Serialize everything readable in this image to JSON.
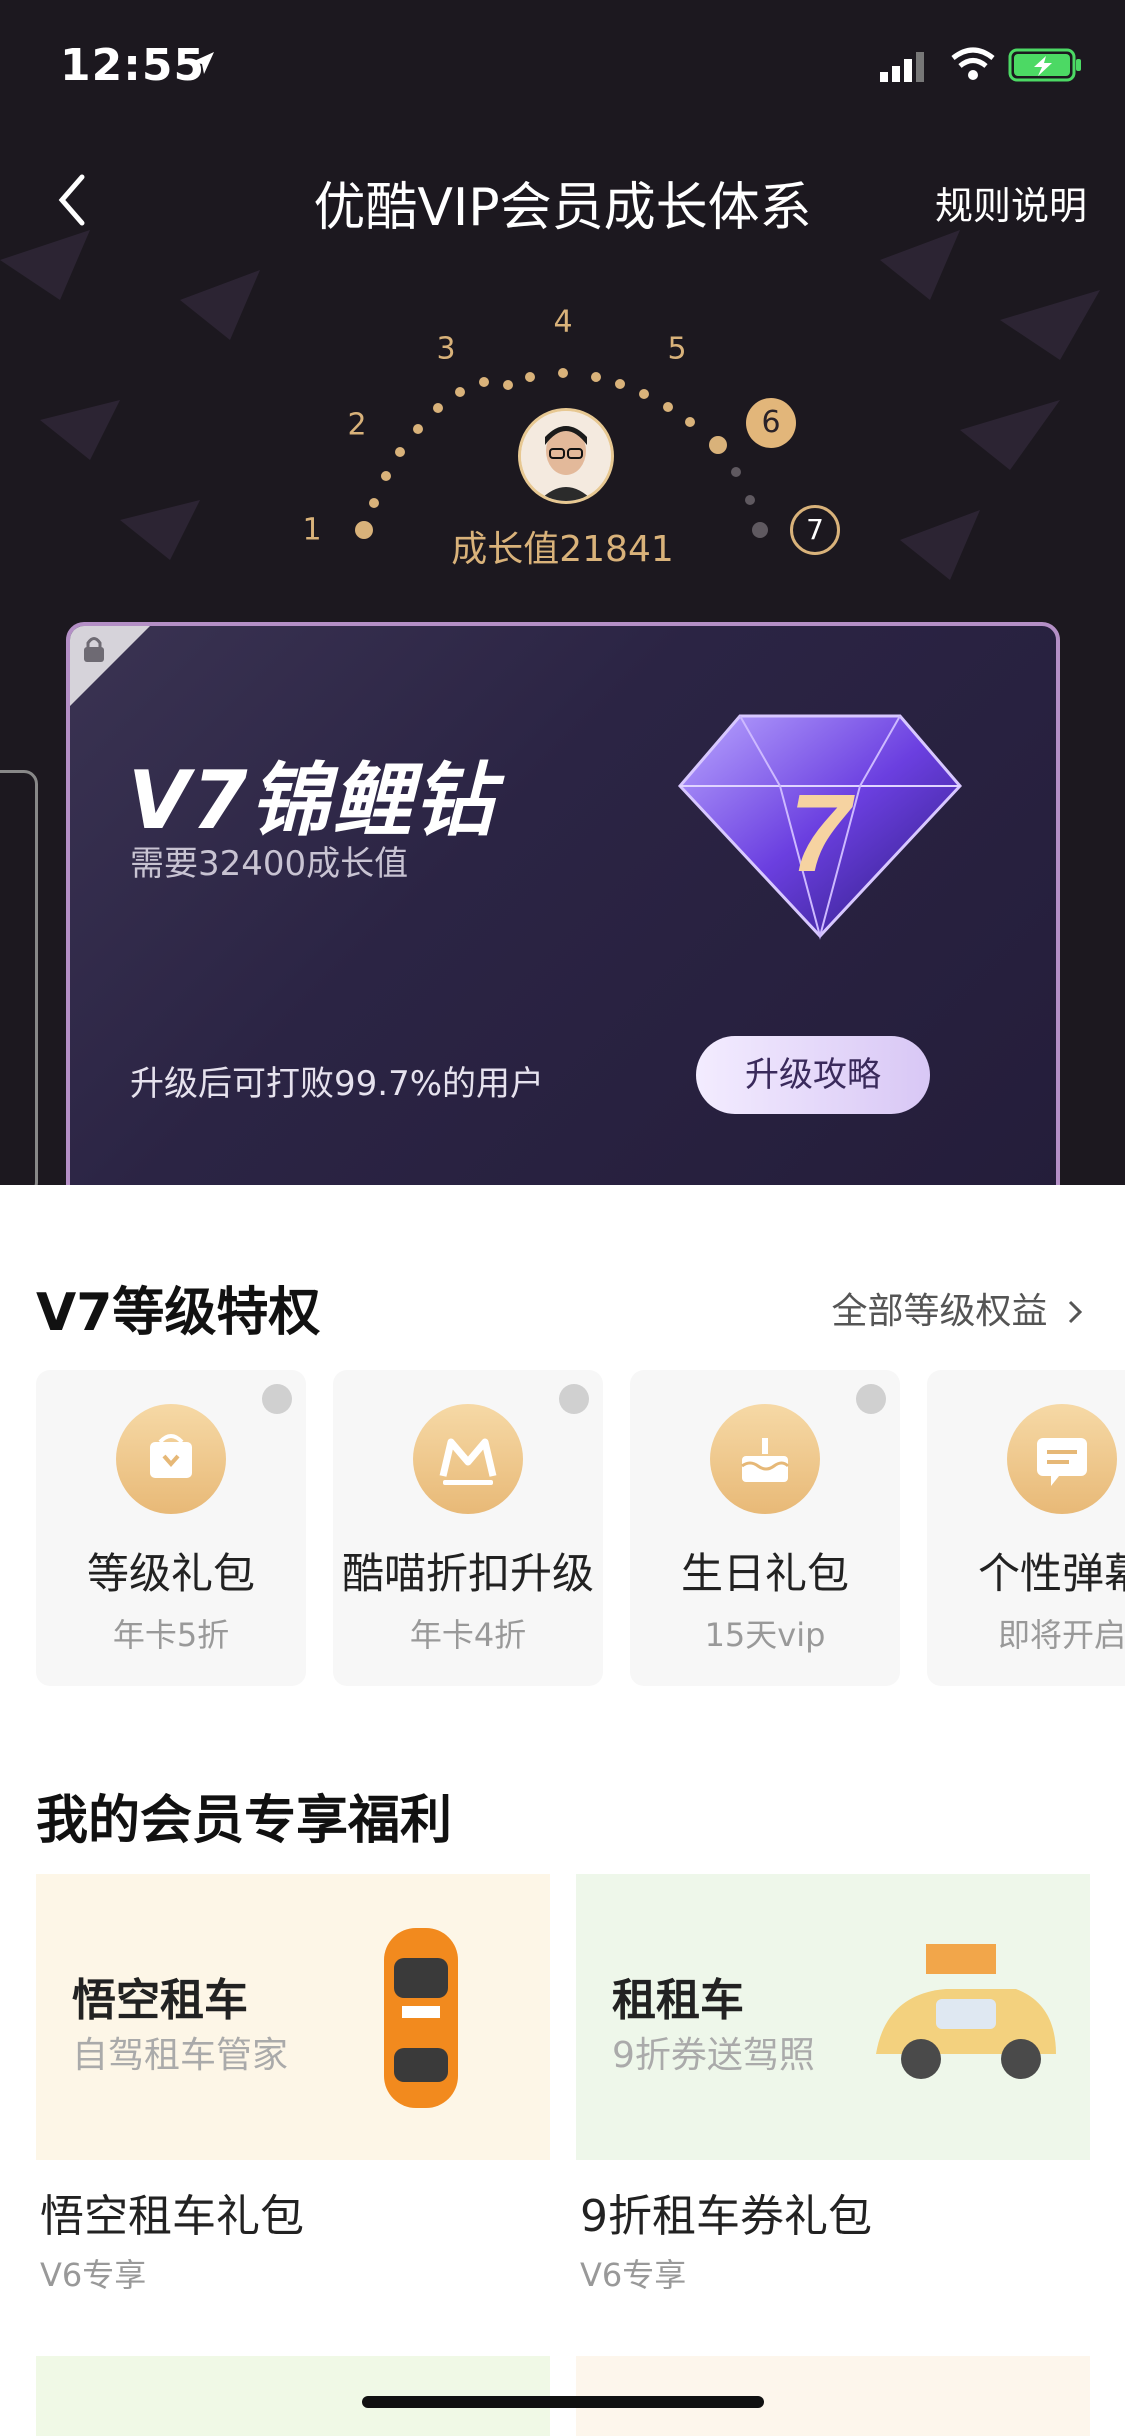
{
  "status_bar": {
    "time": "12:55"
  },
  "nav": {
    "title": "优酷VIP会员成长体系",
    "rules_link": "规则说明"
  },
  "levels": {
    "labels": [
      "1",
      "2",
      "3",
      "4",
      "5",
      "6",
      "7"
    ],
    "current": "6",
    "next": "7",
    "growth_text": "成长值21841"
  },
  "card": {
    "title": "V7锦鲤钻",
    "required": "需要32400成长值",
    "beat_text": "升级后可打败99.7%的用户",
    "upgrade_button": "升级攻略",
    "badge_number": "7"
  },
  "privileges": {
    "title": "V7等级特权",
    "all_link": "全部等级权益",
    "items": [
      {
        "name": "等级礼包",
        "desc": "年卡5折",
        "icon": "gift-icon"
      },
      {
        "name": "酷喵折扣升级",
        "desc": "年卡4折",
        "icon": "kumiao-icon"
      },
      {
        "name": "生日礼包",
        "desc": "15天vip",
        "icon": "cake-icon"
      },
      {
        "name": "个性弹幕",
        "desc": "即将开启",
        "icon": "bullet-comment-icon"
      }
    ]
  },
  "benefits": {
    "title": "我的会员专享福利",
    "items": [
      {
        "name": "悟空租车",
        "sub": "自驾租车管家",
        "title": "悟空租车礼包",
        "tag": "V6专享",
        "bg": "#fdf6e7"
      },
      {
        "name": "租租车",
        "sub": "9折券送驾照",
        "title": "9折租车券礼包",
        "tag": "V6专享",
        "bg": "#eef7ea"
      }
    ]
  },
  "colors": {
    "gold": "#d9b27a",
    "hero_bg": "#1c181f",
    "accent_purple": "#b48fc6"
  }
}
